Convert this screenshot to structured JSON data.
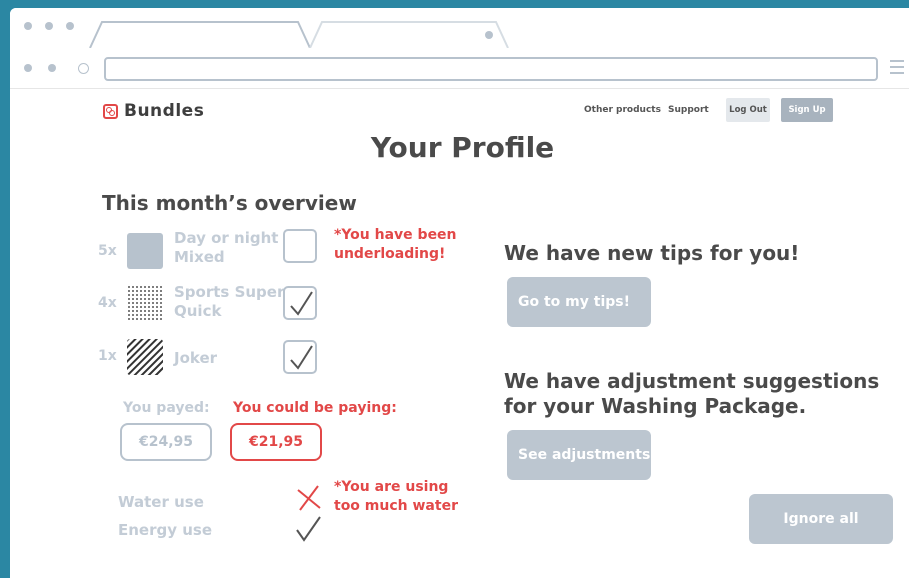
{
  "header": {
    "brand": "Bundles",
    "nav": [
      "Other products",
      "Support"
    ],
    "login_label": "Log Out",
    "signup_label": "Sign Up"
  },
  "page": {
    "title": "Your Profile"
  },
  "overview": {
    "title": "This month’s overview",
    "rows": [
      {
        "count": "5x",
        "label_line1": "Day or night",
        "label_line2": "Mixed",
        "checked": false
      },
      {
        "count": "4x",
        "label_line1": "Sports Super",
        "label_line2": "Quick",
        "checked": true
      },
      {
        "count": "1x",
        "label_line1": "Joker",
        "label_line2": "",
        "checked": true
      }
    ],
    "warning_line1": "*You have been",
    "warning_line2": "underloading!"
  },
  "pricing": {
    "paid_label": "You payed:",
    "paid_value": "€24,95",
    "could_label": "You could be paying:",
    "could_value": "€21,95"
  },
  "usage": {
    "water_label": "Water use",
    "energy_label": "Energy use",
    "warning_line1": "*You are using",
    "warning_line2": "too much water"
  },
  "tips": {
    "heading": "We have new tips for you!",
    "button_label": "Go to my tips!"
  },
  "adjustments": {
    "heading_line1": "We have adjustment suggestions",
    "heading_line2": "for your Washing Package.",
    "button_label": "See adjustments"
  },
  "footer": {
    "ignore_label": "Ignore all"
  },
  "colors": {
    "accent_red": "#e24848",
    "muted_blue_gray": "#b7c2cd",
    "text_dark": "#4a4a4a",
    "background": "#2b87a3"
  }
}
